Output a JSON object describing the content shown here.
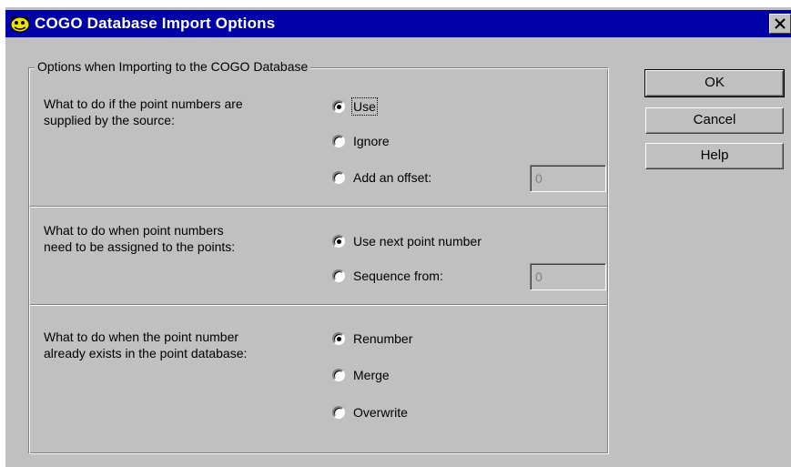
{
  "window": {
    "title": "COGO Database Import Options",
    "title_icon": "cogo-app-icon",
    "close_icon": "close-icon"
  },
  "group": {
    "legend": "Options when Importing to the COGO Database"
  },
  "sections": [
    {
      "question_line1": "What to do if the point numbers are",
      "question_line2": "supplied by the source:",
      "options": [
        {
          "label": "Use",
          "checked": true
        },
        {
          "label": "Ignore",
          "checked": false
        },
        {
          "label": "Add an offset:",
          "checked": false
        }
      ],
      "field_value": "0"
    },
    {
      "question_line1": "What to do when point numbers",
      "question_line2": "need to be assigned to the points:",
      "options": [
        {
          "label": "Use next point number",
          "checked": true
        },
        {
          "label": "Sequence from:",
          "checked": false
        }
      ],
      "field_value": "0"
    },
    {
      "question_line1": "What to do when the point number",
      "question_line2": "already exists in the point database:",
      "options": [
        {
          "label": "Renumber",
          "checked": true
        },
        {
          "label": "Merge",
          "checked": false
        },
        {
          "label": "Overwrite",
          "checked": false
        }
      ]
    }
  ],
  "buttons": {
    "ok": "OK",
    "cancel": "Cancel",
    "help": "Help"
  }
}
